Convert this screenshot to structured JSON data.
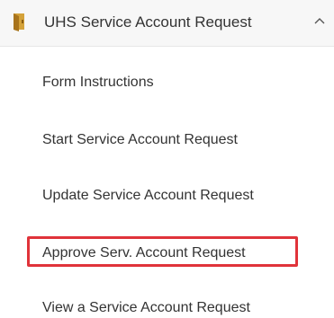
{
  "header": {
    "title": "UHS Service Account Request",
    "icon": "folder-icon",
    "toggle_icon": "chevron-up-icon",
    "icon_color": "#c8962c"
  },
  "menu": {
    "items": [
      {
        "label": "Form Instructions"
      },
      {
        "label": "Start Service Account Request"
      },
      {
        "label": "Update Service Account Request"
      },
      {
        "label": "Approve Serv. Account Request",
        "highlighted": true
      },
      {
        "label": "View a Service Account Request"
      }
    ]
  },
  "colors": {
    "highlight_border": "#e0333a",
    "header_background": "#f7f7f7",
    "text": "#333333"
  }
}
